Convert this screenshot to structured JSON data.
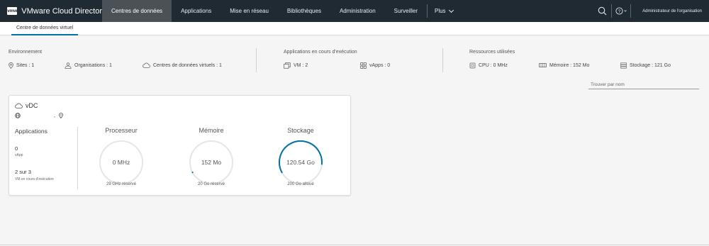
{
  "header": {
    "logo": "vmw",
    "title": "VMware Cloud Director",
    "nav": [
      {
        "label": "Centres de données",
        "active": true
      },
      {
        "label": "Applications"
      },
      {
        "label": "Mise en réseau"
      },
      {
        "label": "Bibliothèques"
      },
      {
        "label": "Administration"
      },
      {
        "label": "Surveiller"
      }
    ],
    "more": "Plus",
    "user": "Administrateur de l'organisation",
    "icons": {
      "search": "search-icon",
      "help": "help-icon"
    }
  },
  "subnav": {
    "tab": "Centre de données virtuel"
  },
  "summary": {
    "environment": {
      "title": "Environnement",
      "sites": "Sites : 1",
      "organizations": "Organisations : 1",
      "vdcs": "Centres de données virtuels : 1"
    },
    "running_apps": {
      "title": "Applications en cours d'exécution",
      "vm": "VM : 2",
      "vapps": "vApps : 0"
    },
    "resources": {
      "title": "Ressources utilisées",
      "cpu": "CPU : 0 MHz",
      "memory": "Mémoire : 152 Mo",
      "storage": "Stockage : 121 Go"
    }
  },
  "search": {
    "placeholder": "Trouver par nom"
  },
  "card": {
    "title": "vDC",
    "sub_suffix": ",",
    "applications": {
      "title": "Applications",
      "vapp_count": "0",
      "vapp_label": "vApp",
      "vm_count": "2 sur 3",
      "vm_label": "VM en cours d'exécution"
    },
    "cpu": {
      "title": "Processeur",
      "value": "0 MHz",
      "footer": "29 GHz réservé",
      "usage": 0
    },
    "memory": {
      "title": "Mémoire",
      "value": "152 Mo",
      "footer": "20 Go réservé",
      "usage": 0.01
    },
    "storage": {
      "title": "Stockage",
      "value": "120.54 Go",
      "footer": "200 Go alloué",
      "usage": 0.6
    }
  },
  "colors": {
    "header_bg": "#1f2a33",
    "accent": "#0072a3",
    "gauge_track": "#e6e6e6"
  }
}
